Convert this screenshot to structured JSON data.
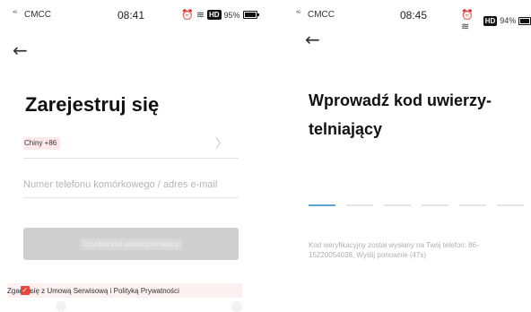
{
  "left_screen": {
    "status_bar": {
      "signal": "⁴ᴳ",
      "carrier": "CMCC",
      "time": "08:41",
      "icons": "⏰ ≋",
      "hd": "HD",
      "battery": "95%"
    },
    "back_label": "←",
    "title": "Zarejestruj się",
    "country": {
      "value": "Chiny +86",
      "chevron": "〉"
    },
    "phone_input": {
      "value": "",
      "placeholder": "Numer telefonu komórkowego / adres e-mail"
    },
    "get_code_button": "Uzyskaj kod uwierzytelniający",
    "terms": {
      "prefix": "Zgadza",
      "checkbox_mark": "✓",
      "text": " się z Umową Serwisową i Polityką Prywatności"
    }
  },
  "right_screen": {
    "status_bar": {
      "signal": "⁴ᴳ",
      "carrier": "CMCC",
      "time": "08:45",
      "icons": "⏰ ≋",
      "hd": "HD",
      "battery": "94%"
    },
    "back_label": "←",
    "title": "Wprowadź kod uwierzy-telniający",
    "code_slots": 6,
    "active_slot": 0,
    "sent_info": "Kod weryfikacyjny został wysłany na Twój telefon: 86-15220054038, Wyślij ponownie (47s)"
  },
  "colors": {
    "accent_checkbox": "#e8453c",
    "active_slot": "#5aa6d9",
    "disabled_button": "#cfcfcf"
  }
}
